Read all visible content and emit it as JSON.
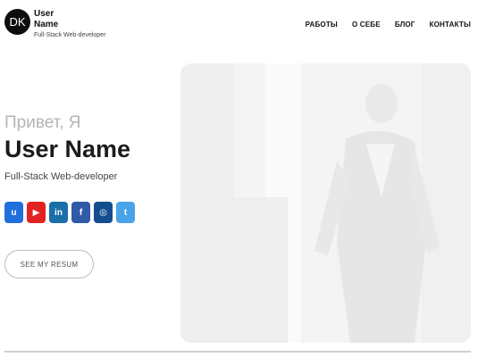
{
  "header": {
    "logo_initials": "DK",
    "brand_name": "User Name",
    "brand_subtitle": "Full-Stack Web-developer",
    "nav": [
      "РАБОТЫ",
      "О СЕБЕ",
      "БЛОГ",
      "КОНТАКТЫ"
    ]
  },
  "hero": {
    "greeting": "Привет, Я",
    "name": "User Name",
    "role": "Full-Stack Web-developer",
    "resume_button": "SEE MY RESUM"
  },
  "socials": [
    {
      "icon": "upwork-icon",
      "glyph": "u",
      "color": "#1f6fdc"
    },
    {
      "icon": "youtube-icon",
      "glyph": "▶",
      "color": "#e32222"
    },
    {
      "icon": "linkedin-icon",
      "glyph": "in",
      "color": "#1a6fa8"
    },
    {
      "icon": "facebook-icon",
      "glyph": "f",
      "color": "#2f5aa8"
    },
    {
      "icon": "instagram-icon",
      "glyph": "◎",
      "color": "#134e8f"
    },
    {
      "icon": "twitter-icon",
      "glyph": "t",
      "color": "#4aa3e8"
    }
  ],
  "colors": {
    "text_dark": "#1b1b1b",
    "greeting_gray": "#b5b5b5",
    "photo_bg": "#f3f3f3"
  }
}
